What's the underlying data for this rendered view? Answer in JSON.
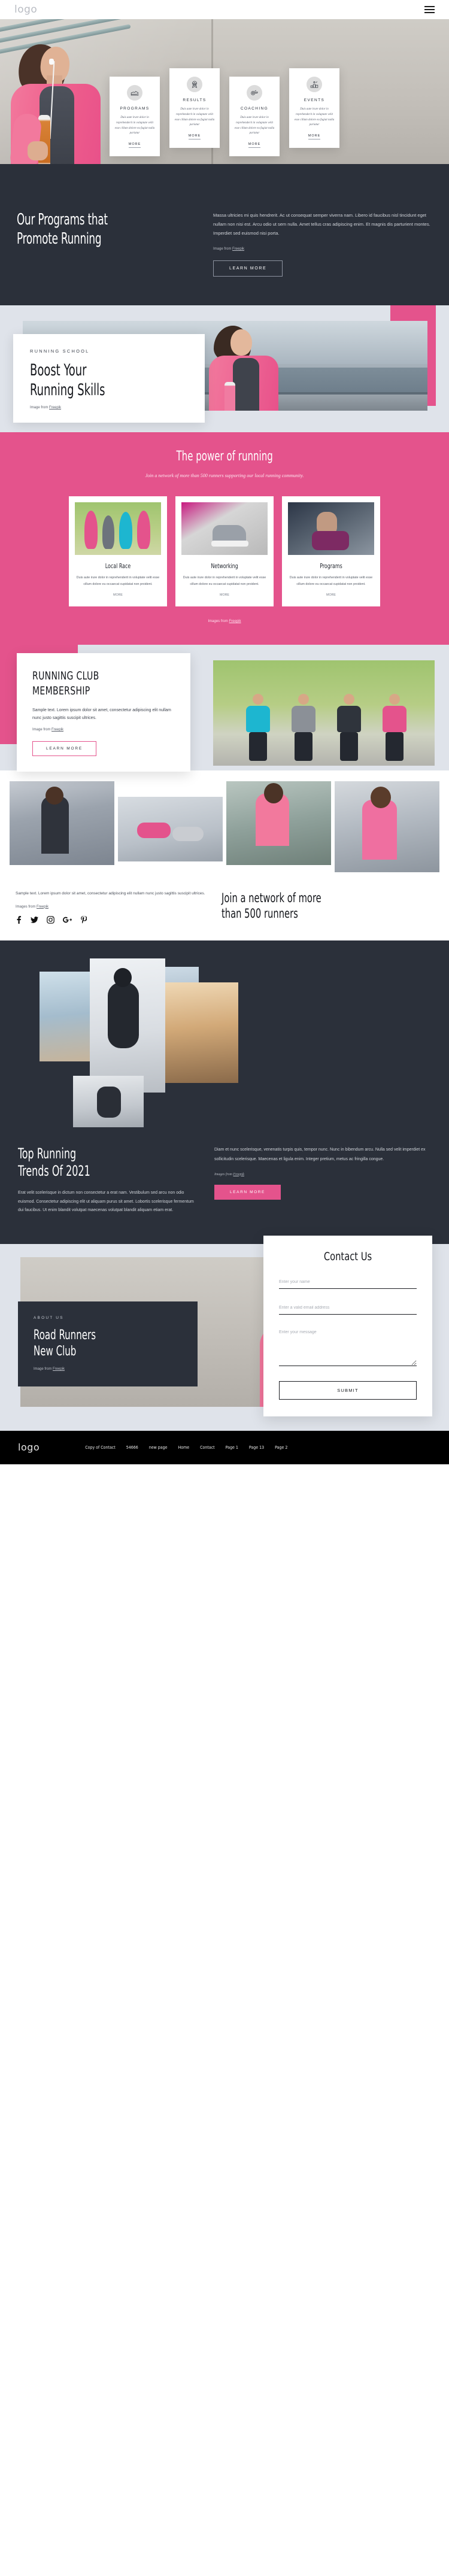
{
  "header": {
    "logo": "logo",
    "menu_icon": "hamburger-menu-icon"
  },
  "hero": {
    "cards": [
      {
        "icon": "running-shoe-icon",
        "title": "PROGRAMS",
        "text": "Duis aute irure dolor in reprehenderit in voluptate velit esse cillum dolore eu fugiat nulla pariatur",
        "more": "MORE"
      },
      {
        "icon": "award-badge-icon",
        "title": "RESULTS",
        "text": "Duis aute irure dolor in reprehenderit in voluptate velit esse cillum dolore eu fugiat nulla pariatur",
        "more": "MORE"
      },
      {
        "icon": "whistle-icon",
        "title": "COACHING",
        "text": "Duis aute irure dolor in reprehenderit in voluptate velit esse cillum dolore eu fugiat nulla pariatur",
        "more": "MORE"
      },
      {
        "icon": "podium-winner-icon",
        "title": "EVENTS",
        "text": "Duis aute irure dolor in reprehenderit in voluptate velit esse cillum dolore eu fugiat nulla pariatur",
        "more": "MORE"
      }
    ]
  },
  "programs": {
    "title_line1": "Our Programs that",
    "title_line2": "Promote Running",
    "body": "Massa ultricies mi quis hendrerit. Ac ut consequat semper viverra nam. Libero id faucibus nisl tincidunt eget nullam non nisi est. Arcu odio ut sem nulla. Amet tellus cras adipiscing enim. Et magnis dis parturient montes. Imperdiet sed euismod nisi porta.",
    "credit_prefix": "Image from ",
    "credit_link": "Freepik",
    "button": "LEARN MORE"
  },
  "boost": {
    "eyebrow": "RUNNING SCHOOL",
    "title_line1": "Boost Your",
    "title_line2": "Running Skills",
    "credit_prefix": "Image from ",
    "credit_link": "Freepik"
  },
  "power": {
    "title": "The power of running",
    "subtitle": "Join a network of more than 500 runners supporting our local running community.",
    "cards": [
      {
        "title": "Local Race",
        "text": "Duis aute irure dolor in reprehenderit in voluptate velit esse cillum dolore eu occaecat cupidatat non proident.",
        "more": "MORE"
      },
      {
        "title": "Networking",
        "text": "Duis aute irure dolor in reprehenderit in voluptate velit esse cillum dolore eu occaecat cupidatat non proident.",
        "more": "MORE"
      },
      {
        "title": "Programs",
        "text": "Duis aute irure dolor in reprehenderit in voluptate velit esse cillum dolore eu occaecat cupidatat non proident.",
        "more": "MORE"
      }
    ],
    "credit_prefix": "Images from ",
    "credit_link": "Freepik"
  },
  "membership": {
    "title_line1": "RUNNING CLUB",
    "title_line2": "MEMBERSHIP",
    "text": "Sample text. Lorem ipsum dolor sit amet, consectetur adipiscing elit nullam nunc justo sagittis suscipit ultrices.",
    "credit_prefix": "Image from ",
    "credit_link": "Freepik",
    "button": "LEARN MORE"
  },
  "network": {
    "text": "Sample text. Lorem ipsum dolor sit amet, consectetur adipiscing elit nullam nunc justo sagittis suscipit ultrices.",
    "credit_prefix": "Images from ",
    "credit_link": "Freepik",
    "title_line1": "Join a network of more",
    "title_line2": "than 500 runners",
    "social": [
      "facebook-icon",
      "twitter-icon",
      "instagram-icon",
      "google-plus-icon",
      "pinterest-icon"
    ],
    "social_glyphs": [
      "f",
      "ƒ",
      "▢",
      "G+",
      "℗"
    ]
  },
  "trends": {
    "title_line1": "Top Running",
    "title_line2": "Trends Of 2021",
    "text_left": "Erat velit scelerisque in dictum non consectetur a erat nam. Vestibulum sed arcu non odio euismod. Consectetur adipiscing elit ut aliquam purus sit amet. Lobortis scelerisque fermentum dui faucibus. Ut enim blandit volutpat maecenas volutpat blandit aliquam etiam erat.",
    "text_right": "Diam et nunc scelerisque, venenatis turpis quis, tempor nunc. Nunc in bibendum arcu. Nulla sed velit imperdiet ex sollicitudin scelerisque. Maecenas et ligula enim. Integer pretium, metus ac fringilla congue.",
    "credit_prefix": "Images from ",
    "credit_link": "Freepik",
    "button": "LEARN MORE"
  },
  "about": {
    "eyebrow": "ABOUT US",
    "title_line1": "Road Runners",
    "title_line2": "New Club",
    "credit_prefix": "Image from ",
    "credit_link": "Freepik"
  },
  "contact": {
    "title": "Contact Us",
    "name_placeholder": "Enter your name",
    "email_placeholder": "Enter a valid email address",
    "message_placeholder": "Enter your message",
    "submit": "SUBMIT"
  },
  "footer": {
    "logo": "logo",
    "links": [
      "Copy of Contact",
      "54666",
      "new page",
      "Home",
      "Contact",
      "Page 1",
      "Page 13",
      "Page 2"
    ]
  },
  "colors": {
    "pink": "#e4538c",
    "dark": "#2b303a",
    "light": "#dfe3ea"
  }
}
